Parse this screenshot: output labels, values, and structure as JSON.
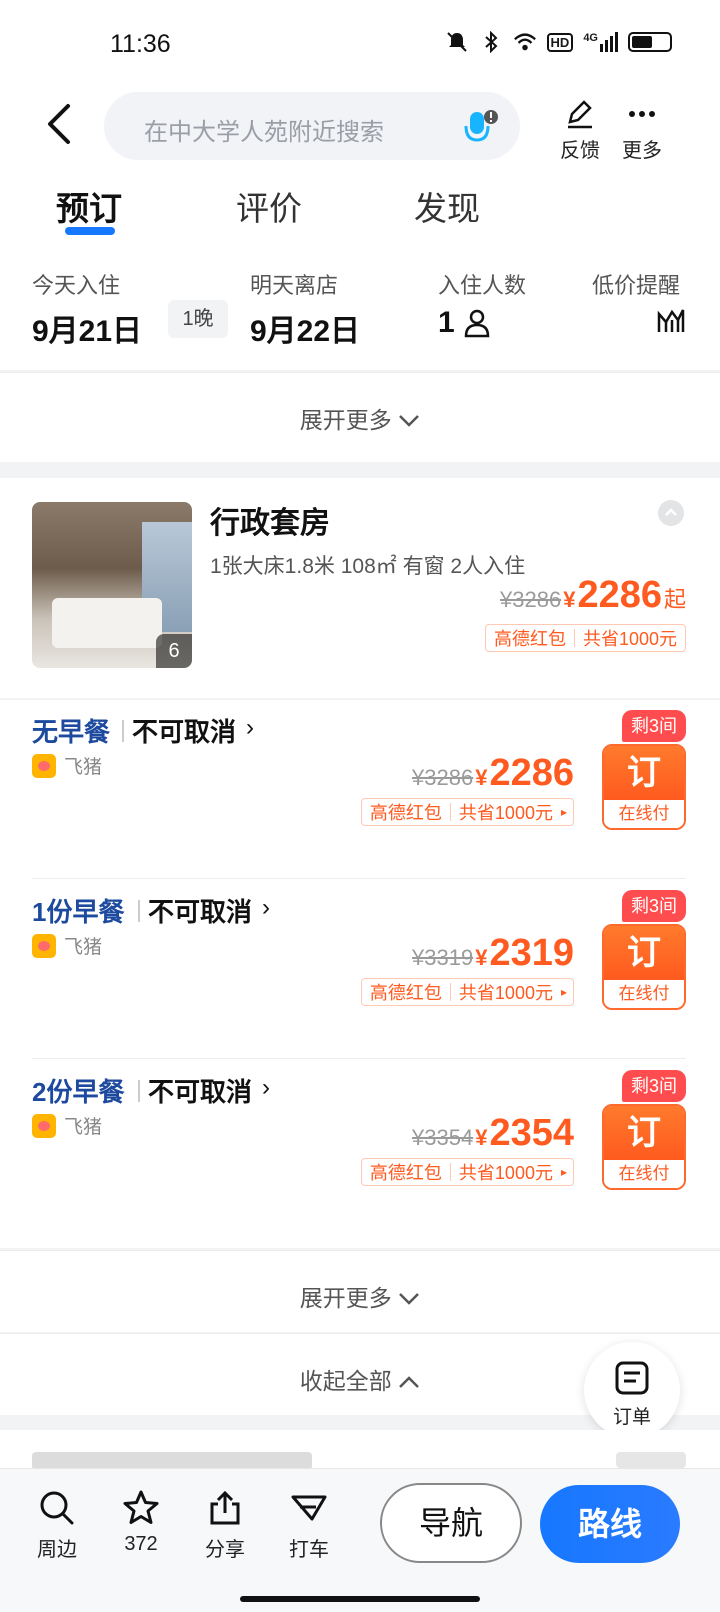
{
  "status_bar": {
    "time": "11:36",
    "hd": "HD",
    "network": "4G"
  },
  "search": {
    "placeholder": "在中大学人苑附近搜索",
    "feedback_label": "反馈",
    "more_label": "更多"
  },
  "tabs": [
    {
      "label": "预订",
      "active": true
    },
    {
      "label": "评价",
      "active": false
    },
    {
      "label": "发现",
      "active": false
    }
  ],
  "booking_bar": {
    "checkin_title": "今天入住",
    "checkin_date": "9月21日",
    "nights": "1晚",
    "checkout_title": "明天离店",
    "checkout_date": "9月22日",
    "guests_title": "入住人数",
    "guests": "1",
    "price_alert": "低价提醒"
  },
  "expand_more": "展开更多",
  "room": {
    "name": "行政套房",
    "spec": "1张大床1.8米  108㎡  有窗  2人入住",
    "photo_count": "6",
    "old_price": "¥3286",
    "currency": "¥",
    "price": "2286",
    "price_suffix": "起",
    "promo_name": "高德红包",
    "promo_saving": "共省1000元"
  },
  "rates": [
    {
      "meal": "无早餐",
      "cancel": "不可取消",
      "vendor": "飞猪",
      "old_price": "¥3286",
      "currency": "¥",
      "price": "2286",
      "promo_name": "高德红包",
      "promo_saving": "共省1000元",
      "remaining": "剩3间",
      "book": "订",
      "pay": "在线付"
    },
    {
      "meal": "1份早餐",
      "cancel": "不可取消",
      "vendor": "飞猪",
      "old_price": "¥3319",
      "currency": "¥",
      "price": "2319",
      "promo_name": "高德红包",
      "promo_saving": "共省1000元",
      "remaining": "剩3间",
      "book": "订",
      "pay": "在线付"
    },
    {
      "meal": "2份早餐",
      "cancel": "不可取消",
      "vendor": "飞猪",
      "old_price": "¥3354",
      "currency": "¥",
      "price": "2354",
      "promo_name": "高德红包",
      "promo_saving": "共省1000元",
      "remaining": "剩3间",
      "book": "订",
      "pay": "在线付"
    }
  ],
  "collapse_all": "收起全部",
  "order_fab": "订单",
  "bottom_bar": {
    "nearby": "周边",
    "favorites": "372",
    "share": "分享",
    "taxi": "打车",
    "navigate": "导航",
    "route": "路线"
  },
  "colors": {
    "accent": "#1677ff",
    "price": "#ff5a1f",
    "meal": "#1d4a9e"
  }
}
